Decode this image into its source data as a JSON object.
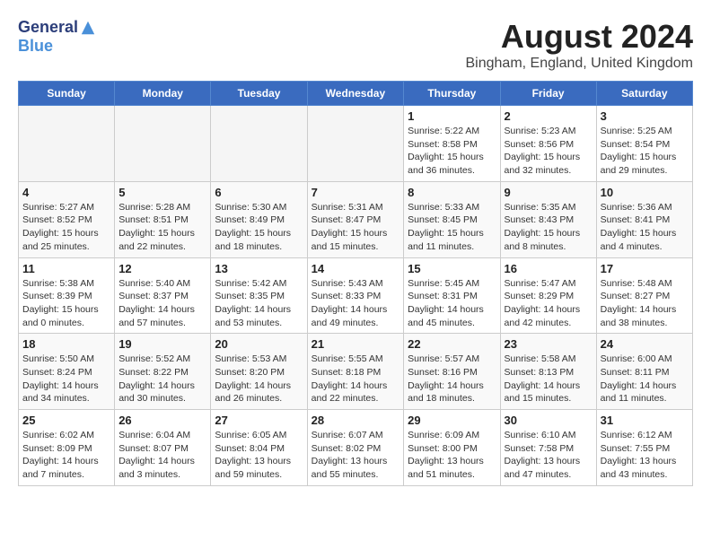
{
  "header": {
    "logo_general": "General",
    "logo_blue": "Blue",
    "month_year": "August 2024",
    "location": "Bingham, England, United Kingdom"
  },
  "days_of_week": [
    "Sunday",
    "Monday",
    "Tuesday",
    "Wednesday",
    "Thursday",
    "Friday",
    "Saturday"
  ],
  "weeks": [
    [
      {
        "day": "",
        "empty": true
      },
      {
        "day": "",
        "empty": true
      },
      {
        "day": "",
        "empty": true
      },
      {
        "day": "",
        "empty": true
      },
      {
        "day": "1",
        "sunrise": "Sunrise: 5:22 AM",
        "sunset": "Sunset: 8:58 PM",
        "daylight": "Daylight: 15 hours and 36 minutes."
      },
      {
        "day": "2",
        "sunrise": "Sunrise: 5:23 AM",
        "sunset": "Sunset: 8:56 PM",
        "daylight": "Daylight: 15 hours and 32 minutes."
      },
      {
        "day": "3",
        "sunrise": "Sunrise: 5:25 AM",
        "sunset": "Sunset: 8:54 PM",
        "daylight": "Daylight: 15 hours and 29 minutes."
      }
    ],
    [
      {
        "day": "4",
        "sunrise": "Sunrise: 5:27 AM",
        "sunset": "Sunset: 8:52 PM",
        "daylight": "Daylight: 15 hours and 25 minutes."
      },
      {
        "day": "5",
        "sunrise": "Sunrise: 5:28 AM",
        "sunset": "Sunset: 8:51 PM",
        "daylight": "Daylight: 15 hours and 22 minutes."
      },
      {
        "day": "6",
        "sunrise": "Sunrise: 5:30 AM",
        "sunset": "Sunset: 8:49 PM",
        "daylight": "Daylight: 15 hours and 18 minutes."
      },
      {
        "day": "7",
        "sunrise": "Sunrise: 5:31 AM",
        "sunset": "Sunset: 8:47 PM",
        "daylight": "Daylight: 15 hours and 15 minutes."
      },
      {
        "day": "8",
        "sunrise": "Sunrise: 5:33 AM",
        "sunset": "Sunset: 8:45 PM",
        "daylight": "Daylight: 15 hours and 11 minutes."
      },
      {
        "day": "9",
        "sunrise": "Sunrise: 5:35 AM",
        "sunset": "Sunset: 8:43 PM",
        "daylight": "Daylight: 15 hours and 8 minutes."
      },
      {
        "day": "10",
        "sunrise": "Sunrise: 5:36 AM",
        "sunset": "Sunset: 8:41 PM",
        "daylight": "Daylight: 15 hours and 4 minutes."
      }
    ],
    [
      {
        "day": "11",
        "sunrise": "Sunrise: 5:38 AM",
        "sunset": "Sunset: 8:39 PM",
        "daylight": "Daylight: 15 hours and 0 minutes."
      },
      {
        "day": "12",
        "sunrise": "Sunrise: 5:40 AM",
        "sunset": "Sunset: 8:37 PM",
        "daylight": "Daylight: 14 hours and 57 minutes."
      },
      {
        "day": "13",
        "sunrise": "Sunrise: 5:42 AM",
        "sunset": "Sunset: 8:35 PM",
        "daylight": "Daylight: 14 hours and 53 minutes."
      },
      {
        "day": "14",
        "sunrise": "Sunrise: 5:43 AM",
        "sunset": "Sunset: 8:33 PM",
        "daylight": "Daylight: 14 hours and 49 minutes."
      },
      {
        "day": "15",
        "sunrise": "Sunrise: 5:45 AM",
        "sunset": "Sunset: 8:31 PM",
        "daylight": "Daylight: 14 hours and 45 minutes."
      },
      {
        "day": "16",
        "sunrise": "Sunrise: 5:47 AM",
        "sunset": "Sunset: 8:29 PM",
        "daylight": "Daylight: 14 hours and 42 minutes."
      },
      {
        "day": "17",
        "sunrise": "Sunrise: 5:48 AM",
        "sunset": "Sunset: 8:27 PM",
        "daylight": "Daylight: 14 hours and 38 minutes."
      }
    ],
    [
      {
        "day": "18",
        "sunrise": "Sunrise: 5:50 AM",
        "sunset": "Sunset: 8:24 PM",
        "daylight": "Daylight: 14 hours and 34 minutes."
      },
      {
        "day": "19",
        "sunrise": "Sunrise: 5:52 AM",
        "sunset": "Sunset: 8:22 PM",
        "daylight": "Daylight: 14 hours and 30 minutes."
      },
      {
        "day": "20",
        "sunrise": "Sunrise: 5:53 AM",
        "sunset": "Sunset: 8:20 PM",
        "daylight": "Daylight: 14 hours and 26 minutes."
      },
      {
        "day": "21",
        "sunrise": "Sunrise: 5:55 AM",
        "sunset": "Sunset: 8:18 PM",
        "daylight": "Daylight: 14 hours and 22 minutes."
      },
      {
        "day": "22",
        "sunrise": "Sunrise: 5:57 AM",
        "sunset": "Sunset: 8:16 PM",
        "daylight": "Daylight: 14 hours and 18 minutes."
      },
      {
        "day": "23",
        "sunrise": "Sunrise: 5:58 AM",
        "sunset": "Sunset: 8:13 PM",
        "daylight": "Daylight: 14 hours and 15 minutes."
      },
      {
        "day": "24",
        "sunrise": "Sunrise: 6:00 AM",
        "sunset": "Sunset: 8:11 PM",
        "daylight": "Daylight: 14 hours and 11 minutes."
      }
    ],
    [
      {
        "day": "25",
        "sunrise": "Sunrise: 6:02 AM",
        "sunset": "Sunset: 8:09 PM",
        "daylight": "Daylight: 14 hours and 7 minutes."
      },
      {
        "day": "26",
        "sunrise": "Sunrise: 6:04 AM",
        "sunset": "Sunset: 8:07 PM",
        "daylight": "Daylight: 14 hours and 3 minutes."
      },
      {
        "day": "27",
        "sunrise": "Sunrise: 6:05 AM",
        "sunset": "Sunset: 8:04 PM",
        "daylight": "Daylight: 13 hours and 59 minutes."
      },
      {
        "day": "28",
        "sunrise": "Sunrise: 6:07 AM",
        "sunset": "Sunset: 8:02 PM",
        "daylight": "Daylight: 13 hours and 55 minutes."
      },
      {
        "day": "29",
        "sunrise": "Sunrise: 6:09 AM",
        "sunset": "Sunset: 8:00 PM",
        "daylight": "Daylight: 13 hours and 51 minutes."
      },
      {
        "day": "30",
        "sunrise": "Sunrise: 6:10 AM",
        "sunset": "Sunset: 7:58 PM",
        "daylight": "Daylight: 13 hours and 47 minutes."
      },
      {
        "day": "31",
        "sunrise": "Sunrise: 6:12 AM",
        "sunset": "Sunset: 7:55 PM",
        "daylight": "Daylight: 13 hours and 43 minutes."
      }
    ]
  ]
}
